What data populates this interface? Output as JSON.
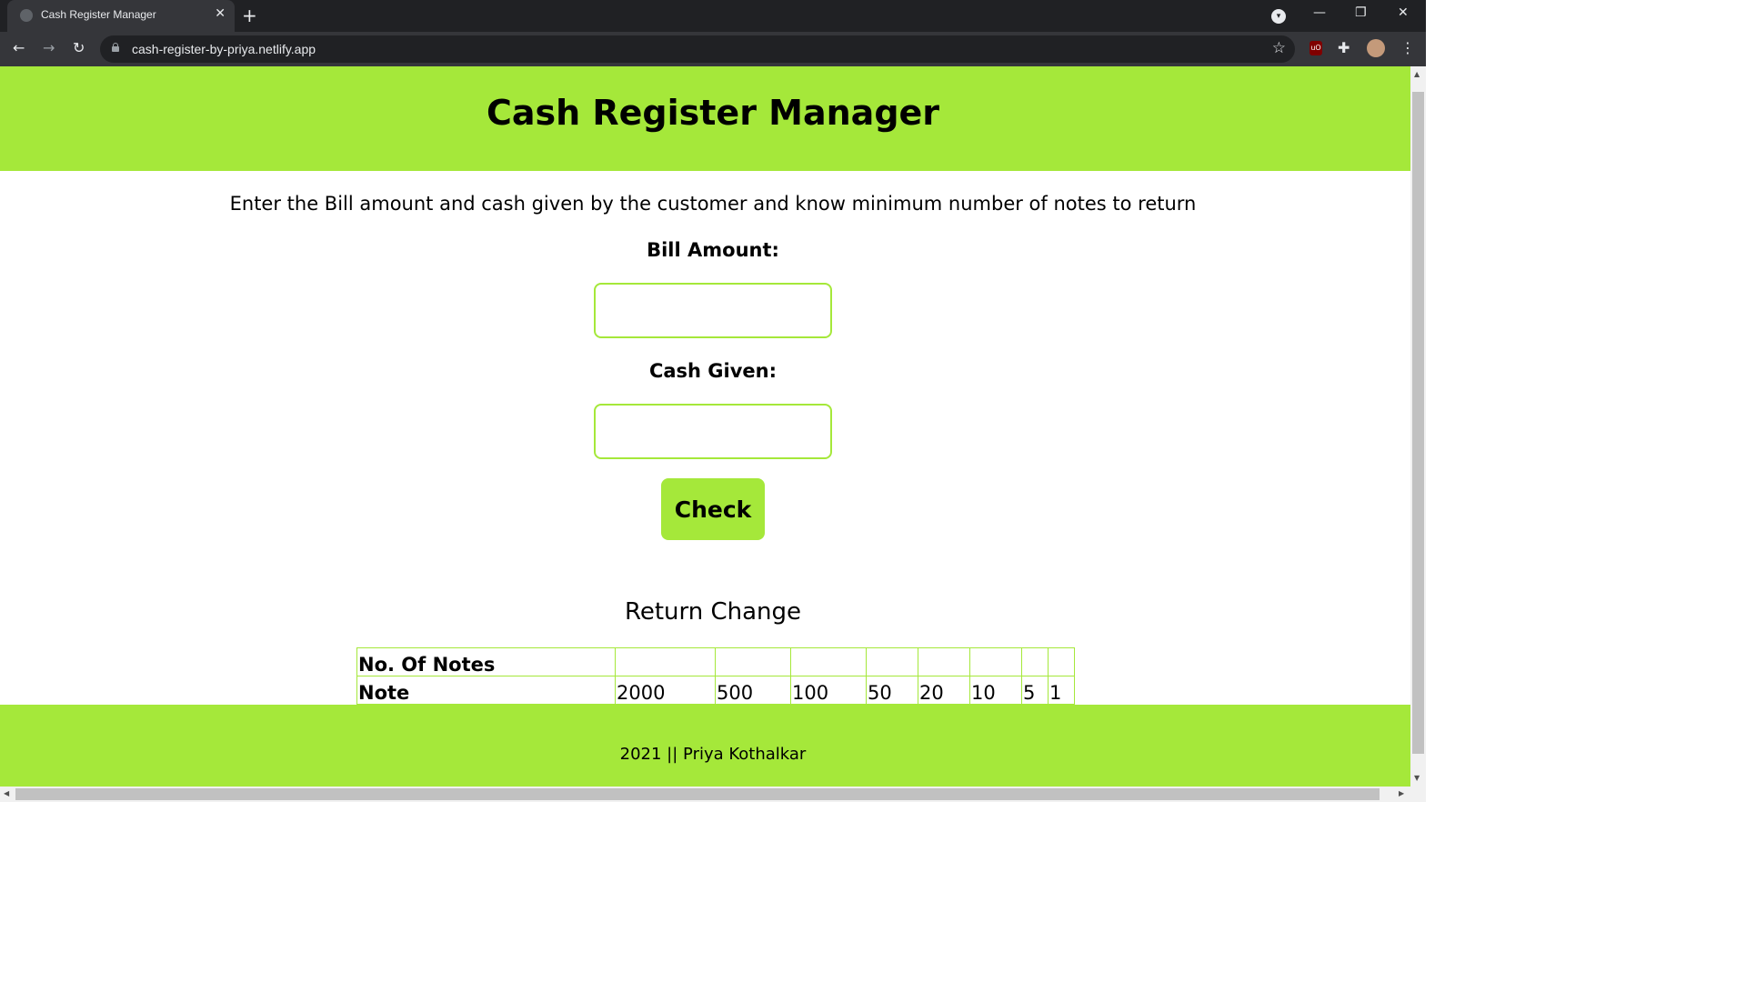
{
  "browser": {
    "tab_title": "Cash Register Manager",
    "tab_close": "✕",
    "new_tab": "+",
    "url": "cash-register-by-priya.netlify.app",
    "icons": [
      "back-icon",
      "forward-icon",
      "reload-icon",
      "lock-icon",
      "star-icon",
      "ublock-icon",
      "extensions-icon",
      "avatar",
      "menu-icon",
      "tab-search-icon",
      "minimize-icon",
      "restore-icon",
      "close-icon"
    ]
  },
  "page": {
    "title": "Cash Register Manager",
    "instructions": "Enter the Bill amount and cash given by the customer and know minimum number of notes to return",
    "bill_label": "Bill Amount:",
    "bill_value": "",
    "cash_label": "Cash Given:",
    "cash_value": "",
    "check_button": "Check",
    "return_title": "Return Change",
    "table": {
      "row1_header": "No. Of Notes",
      "row1_values": [
        "",
        "",
        "",
        "",
        "",
        "",
        "",
        ""
      ],
      "row2_header": "Note",
      "row2_values": [
        "2000",
        "500",
        "100",
        "50",
        "20",
        "10",
        "5",
        "1"
      ]
    },
    "footer": "2021 || Priya Kothalkar"
  },
  "colors": {
    "accent": "#a5e83a",
    "chrome_dark": "#202124",
    "chrome_toolbar": "#35363a"
  }
}
